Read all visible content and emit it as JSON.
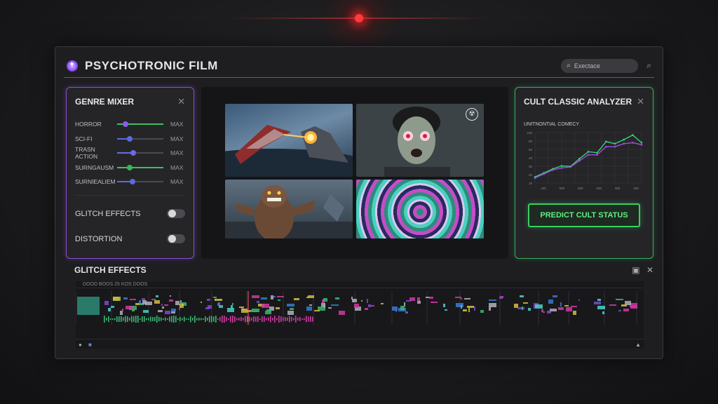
{
  "app": {
    "title": "PSYCHOTRONIC FILM"
  },
  "search": {
    "placeholder": "Exectace"
  },
  "genre_mixer": {
    "title": "GENRE MIXER",
    "sliders": [
      {
        "label": "HORROR",
        "max_label": "MAX",
        "level": 0.18,
        "color": "#8a5cf0"
      },
      {
        "label": "SCI-FI",
        "max_label": "MAX",
        "level": 0.28,
        "color": "#5a6bd8"
      },
      {
        "label": "TRASN ACTION",
        "max_label": "MAX",
        "level": 0.35,
        "color": "#6a6ae8"
      },
      {
        "label": "SURNGAUSM",
        "max_label": "MAX",
        "level": 0.28,
        "color": "#35b85a"
      },
      {
        "label": "SURNIEALIEM",
        "max_label": "MAX",
        "level": 0.33,
        "color": "#5a6bd8"
      }
    ],
    "toggles": [
      {
        "label": "GLITCH EFFECTS",
        "on": false
      },
      {
        "label": "DISTORTION",
        "on": false
      }
    ]
  },
  "cult_analyzer": {
    "title": "CULT CLASSIC ANALYZER",
    "button": "PREDICT CULT STATUS",
    "accent": "#39d060"
  },
  "fx": {
    "title": "GLITCH EFFECTS",
    "ruler_text": "DOOD BOOS 25 KOS DOOS"
  },
  "chart_data": {
    "type": "line",
    "title": "UNITNONTIAL COMECY",
    "x_tick_labels": [
      "100",
      "000",
      "000",
      "000",
      "000",
      "100"
    ],
    "y_tick_labels": [
      "100",
      "80",
      "60",
      "40",
      "30",
      "20",
      "10"
    ],
    "series": [
      {
        "color": "#3ad07a",
        "values": [
          12,
          20,
          28,
          34,
          33,
          48,
          62,
          60,
          82,
          78,
          86,
          95,
          80
        ]
      },
      {
        "color": "#a24de0",
        "values": [
          10,
          18,
          26,
          30,
          32,
          44,
          56,
          56,
          72,
          72,
          78,
          80,
          76
        ]
      }
    ],
    "ylim": [
      0,
      100
    ]
  }
}
